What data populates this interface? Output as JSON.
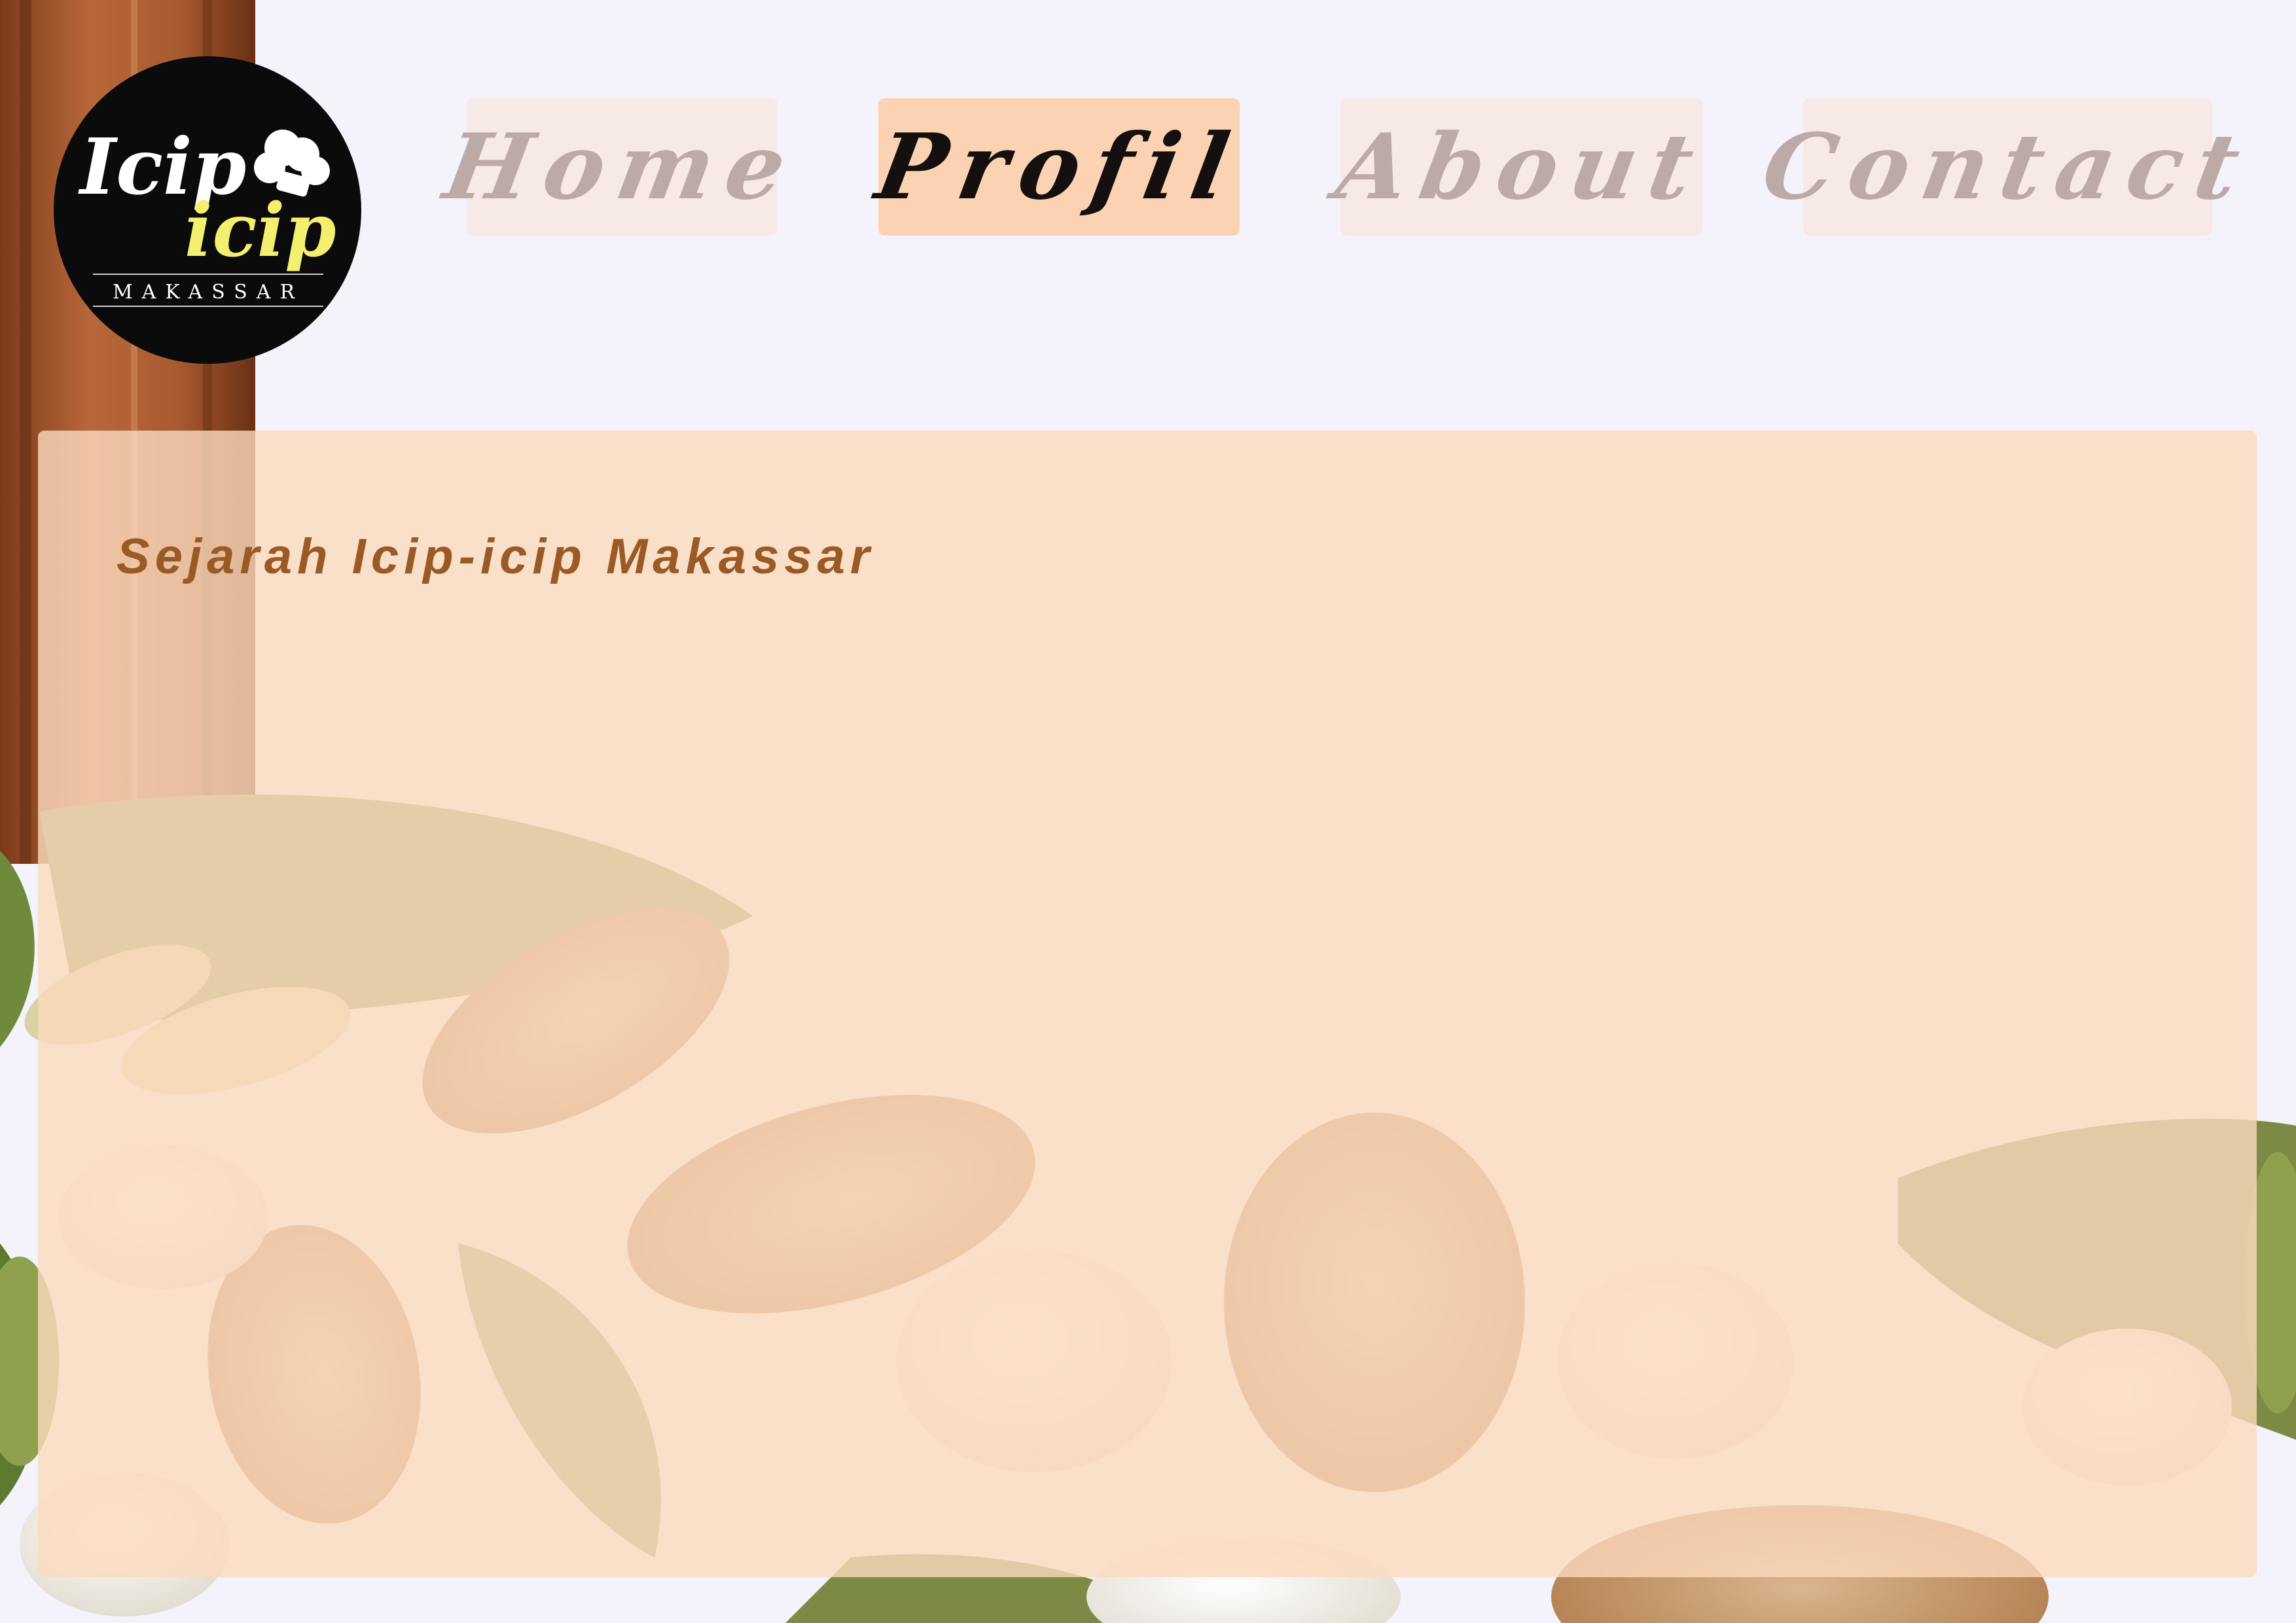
{
  "brand": {
    "logo_line1": "Icip",
    "logo_line2": "icip",
    "logo_line3": "MAKASSAR"
  },
  "nav": {
    "items": [
      {
        "label": "Home"
      },
      {
        "label": "Profil"
      },
      {
        "label": "About"
      },
      {
        "label": "Contact"
      }
    ],
    "active": "Profil"
  },
  "content": {
    "title": "Sejarah Icip-icip Makassar"
  },
  "colors": {
    "page_background": "#f4f2fb",
    "nav_inactive_bg": "#fae2d4",
    "nav_active_bg": "#fbd3b3",
    "nav_inactive_text": "#bcaaa7",
    "nav_active_text": "#15100f",
    "panel_bg": "#fbdabd",
    "title_text": "#9a5a25",
    "logo_bg": "#0b0b0b",
    "logo_yellow": "#f3ef6f"
  }
}
